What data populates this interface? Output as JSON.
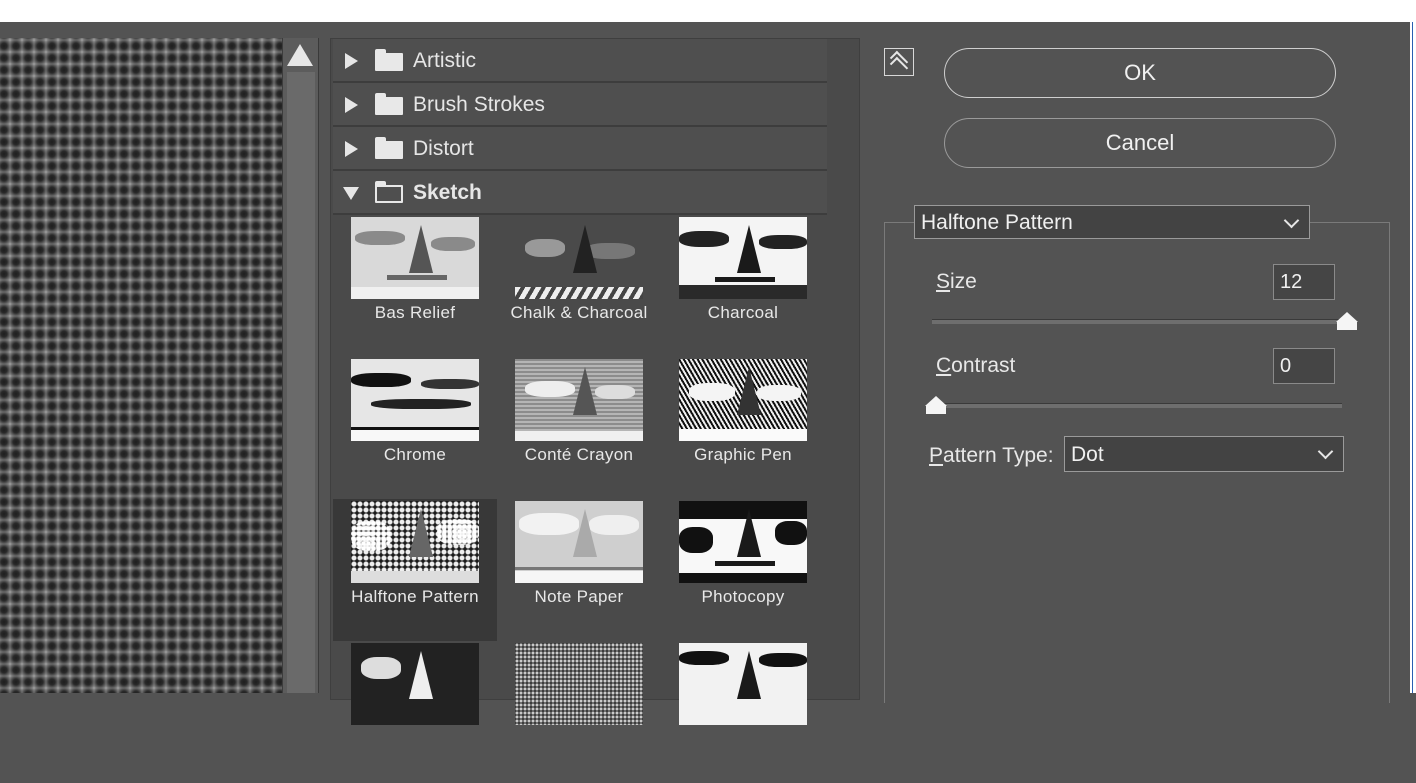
{
  "categories": [
    {
      "label": "Artistic",
      "expanded": false
    },
    {
      "label": "Brush Strokes",
      "expanded": false
    },
    {
      "label": "Distort",
      "expanded": false
    },
    {
      "label": "Sketch",
      "expanded": true
    }
  ],
  "thumbnails": [
    {
      "label": "Bas Relief"
    },
    {
      "label": "Chalk & Charcoal"
    },
    {
      "label": "Charcoal"
    },
    {
      "label": "Chrome"
    },
    {
      "label": "Conté Crayon"
    },
    {
      "label": "Graphic Pen"
    },
    {
      "label": "Halftone Pattern",
      "selected": true
    },
    {
      "label": "Note Paper"
    },
    {
      "label": "Photocopy"
    }
  ],
  "buttons": {
    "ok": "OK",
    "cancel": "Cancel"
  },
  "settings": {
    "filter_name": "Halftone Pattern",
    "size": {
      "label_first": "S",
      "label_rest": "ize",
      "value": "12",
      "level": 1.0
    },
    "contrast": {
      "label_first": "C",
      "label_rest": "ontrast",
      "value": "0",
      "level": 0.0
    },
    "pattern_type": {
      "label_first": "P",
      "label_rest": "attern Type:",
      "value": "Dot"
    }
  },
  "icons": {
    "expand": "triangle-right-icon",
    "collapse": "triangle-down-icon",
    "folder": "folder-icon",
    "toggle": "double-chevron-up-icon",
    "scroll_up": "scroll-up-arrow-icon",
    "dropdown": "chevron-down-icon"
  }
}
